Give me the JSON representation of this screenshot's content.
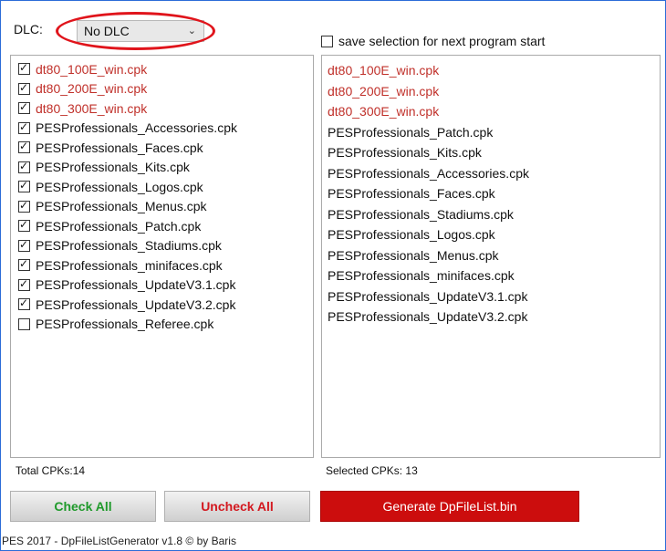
{
  "dlc": {
    "label": "DLC:",
    "selected": "No DLC",
    "chevron_icon": "chevron-down-icon"
  },
  "save_selection": {
    "label": "save selection for next program start",
    "checked": false
  },
  "cpk_list": [
    {
      "name": "dt80_100E_win.cpk",
      "checked": true,
      "highlight": true
    },
    {
      "name": "dt80_200E_win.cpk",
      "checked": true,
      "highlight": true
    },
    {
      "name": "dt80_300E_win.cpk",
      "checked": true,
      "highlight": true
    },
    {
      "name": "PESProfessionals_Accessories.cpk",
      "checked": true,
      "highlight": false
    },
    {
      "name": "PESProfessionals_Faces.cpk",
      "checked": true,
      "highlight": false
    },
    {
      "name": "PESProfessionals_Kits.cpk",
      "checked": true,
      "highlight": false
    },
    {
      "name": "PESProfessionals_Logos.cpk",
      "checked": true,
      "highlight": false
    },
    {
      "name": "PESProfessionals_Menus.cpk",
      "checked": true,
      "highlight": false
    },
    {
      "name": "PESProfessionals_Patch.cpk",
      "checked": true,
      "highlight": false
    },
    {
      "name": "PESProfessionals_Stadiums.cpk",
      "checked": true,
      "highlight": false
    },
    {
      "name": "PESProfessionals_minifaces.cpk",
      "checked": true,
      "highlight": false
    },
    {
      "name": "PESProfessionals_UpdateV3.1.cpk",
      "checked": true,
      "highlight": false
    },
    {
      "name": "PESProfessionals_UpdateV3.2.cpk",
      "checked": true,
      "highlight": false
    },
    {
      "name": "PESProfessionals_Referee.cpk",
      "checked": false,
      "highlight": false
    }
  ],
  "selected_list": [
    {
      "name": "dt80_100E_win.cpk",
      "highlight": true
    },
    {
      "name": "dt80_200E_win.cpk",
      "highlight": true
    },
    {
      "name": "dt80_300E_win.cpk",
      "highlight": true
    },
    {
      "name": "PESProfessionals_Patch.cpk",
      "highlight": false
    },
    {
      "name": "PESProfessionals_Kits.cpk",
      "highlight": false
    },
    {
      "name": "PESProfessionals_Accessories.cpk",
      "highlight": false
    },
    {
      "name": "PESProfessionals_Faces.cpk",
      "highlight": false
    },
    {
      "name": "PESProfessionals_Stadiums.cpk",
      "highlight": false
    },
    {
      "name": "PESProfessionals_Logos.cpk",
      "highlight": false
    },
    {
      "name": "PESProfessionals_Menus.cpk",
      "highlight": false
    },
    {
      "name": "PESProfessionals_minifaces.cpk",
      "highlight": false
    },
    {
      "name": "PESProfessionals_UpdateV3.1.cpk",
      "highlight": false
    },
    {
      "name": "PESProfessionals_UpdateV3.2.cpk",
      "highlight": false
    }
  ],
  "counts": {
    "total_label": "Total CPKs:",
    "total_value": "14",
    "selected_label": "Selected CPKs:",
    "selected_value": "13"
  },
  "buttons": {
    "check_all": "Check All",
    "uncheck_all": "Uncheck All",
    "generate": "Generate DpFileList.bin"
  },
  "status_bar": {
    "text": "PES 2017 - DpFileListGenerator v1.8 © by Baris"
  },
  "colors": {
    "highlight_red": "#c0302a",
    "check_all_green": "#1f9a2b",
    "uncheck_all_red": "#d3181f",
    "generate_bg": "#cc0d0d",
    "annotation_red": "#e0141b"
  }
}
